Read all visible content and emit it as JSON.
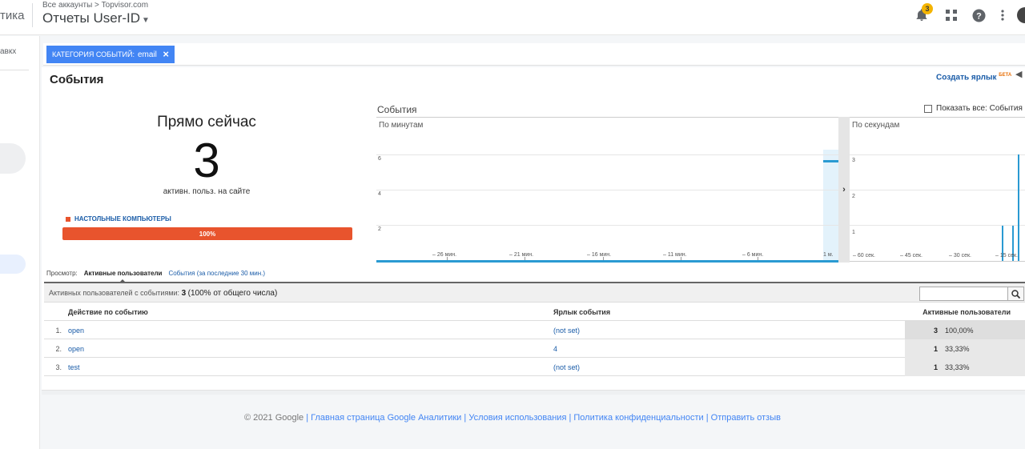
{
  "header": {
    "brand_fragment": "тика",
    "breadcrumb": "Все аккаунты > Topvisor.com",
    "property_title": "Отчеты User-ID",
    "notification_count": "3"
  },
  "sidebar": {
    "text_fragment": "авкх"
  },
  "filter": {
    "category_label": "КАТЕГОРИЯ СОБЫТИЙ:",
    "category_value": "email",
    "close": "×"
  },
  "page": {
    "title": "События",
    "shortcut_label": "Создать ярлык",
    "shortcut_badge": "БЕТА"
  },
  "realtime": {
    "label": "Прямо сейчас",
    "count": "3",
    "sublabel": "активн. польз. на сайте",
    "device_label": "НАСТОЛЬНЫЕ КОМПЬЮТЕРЫ",
    "device_percent": "100%",
    "device_color": "#e8542d"
  },
  "charts": {
    "title": "События",
    "show_all_label": "Показать все: События",
    "pager_arrow": "›"
  },
  "chart_data": [
    {
      "type": "bar",
      "title": "По минутам",
      "y_ticks": [
        "2",
        "4",
        "6"
      ],
      "x_ticks": [
        "– 26 мин.",
        "– 21 мин.",
        "– 16 мин.",
        "– 11 мин.",
        "– 6 мин.",
        "1 м."
      ],
      "ylim": [
        0,
        8
      ],
      "values": [
        {
          "x": "1 м.",
          "y": 6
        }
      ],
      "series_color": "#2a9ad2"
    },
    {
      "type": "bar",
      "title": "По секундам",
      "y_ticks": [
        "1",
        "2",
        "3"
      ],
      "x_ticks": [
        "– 60 сек.",
        "– 45 сек.",
        "– 30 сек.",
        "– 15 сек."
      ],
      "ylim": [
        0,
        3.5
      ],
      "values": [
        {
          "x": "-6",
          "y": 1
        },
        {
          "x": "-3",
          "y": 1
        },
        {
          "x": "-1",
          "y": 3
        }
      ],
      "series_color": "#2a9ad2"
    }
  ],
  "explorer": {
    "prefix": "Просмотр:",
    "active_tab": "Активные пользователи",
    "tab2": "События (за последние 30 мин.)"
  },
  "table": {
    "summary_prefix": "Активных пользователей с событиями:",
    "summary_count": "3",
    "summary_pct": "(100% от общего числа)",
    "search_placeholder": "",
    "headers": {
      "action": "Действие по событию",
      "label": "Ярлык события",
      "users": "Активные пользователи"
    },
    "rows": [
      {
        "num": "1.",
        "action": "open",
        "label": "(not set)",
        "users": "3",
        "pct": "100,00%"
      },
      {
        "num": "2.",
        "action": "open",
        "label": "4",
        "users": "1",
        "pct": "33,33%"
      },
      {
        "num": "3.",
        "action": "test",
        "label": "(not set)",
        "users": "1",
        "pct": "33,33%"
      }
    ]
  },
  "footer": {
    "copyright": "© 2021 Google",
    "links": [
      "Главная страница Google Аналитики",
      "Условия использования",
      "Политика конфиденциальности",
      "Отправить отзыв"
    ],
    "separator": "|"
  }
}
